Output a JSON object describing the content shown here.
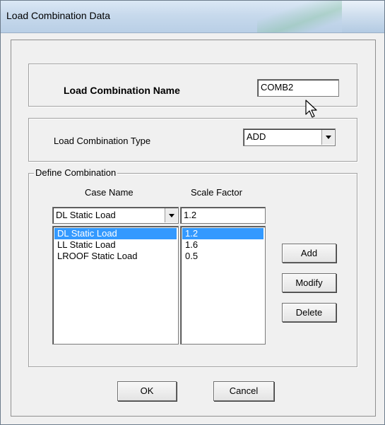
{
  "window": {
    "title": "Load Combination Data"
  },
  "name_section": {
    "label": "Load Combination Name",
    "value": "COMB2"
  },
  "type_section": {
    "label": "Load Combination Type",
    "selected": "ADD"
  },
  "define": {
    "legend": "Define Combination",
    "case_name_header": "Case Name",
    "scale_factor_header": "Scale Factor",
    "case_selected": "DL Static Load",
    "factor_value": "1.2",
    "rows": [
      {
        "case": "DL Static Load",
        "factor": "1.2"
      },
      {
        "case": "LL Static Load",
        "factor": "1.6"
      },
      {
        "case": "LROOF Static Load",
        "factor": "0.5"
      }
    ],
    "add_label": "Add",
    "modify_label": "Modify",
    "delete_label": "Delete"
  },
  "footer": {
    "ok_label": "OK",
    "cancel_label": "Cancel"
  },
  "icons": {
    "pointer": "mouse-pointer-icon",
    "dropdown": "chevron-down-icon"
  },
  "colors": {
    "selection": "#3399ff",
    "titlebar": "#c7d9ec",
    "face": "#f0f0f0"
  }
}
